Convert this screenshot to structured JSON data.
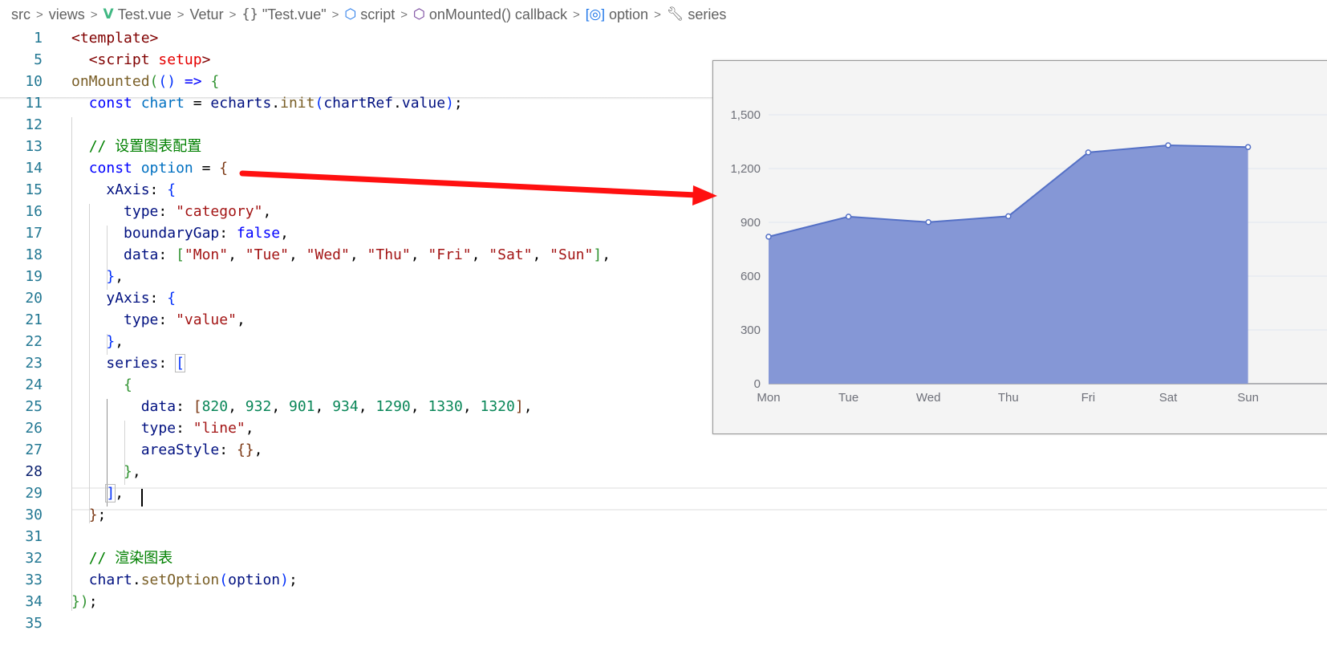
{
  "breadcrumb": [
    {
      "label": "src",
      "icon": ""
    },
    {
      "label": "views",
      "icon": ""
    },
    {
      "label": "Test.vue",
      "icon": "vue-icon"
    },
    {
      "label": "Vetur",
      "icon": ""
    },
    {
      "label": "\"Test.vue\"",
      "icon": "braces-icon"
    },
    {
      "label": "script",
      "icon": "cube-icon"
    },
    {
      "label": "onMounted() callback",
      "icon": "cube-icon"
    },
    {
      "label": "option",
      "icon": "field-icon"
    },
    {
      "label": "series",
      "icon": "wrench-icon"
    }
  ],
  "editor": {
    "line_numbers": [
      "1",
      "5",
      "10",
      "11",
      "12",
      "13",
      "14",
      "15",
      "16",
      "17",
      "18",
      "19",
      "20",
      "21",
      "22",
      "23",
      "24",
      "25",
      "26",
      "27",
      "28",
      "29",
      "30",
      "31",
      "32",
      "33",
      "34",
      "35"
    ],
    "active_line": "28"
  },
  "chart_data": {
    "type": "area",
    "categories": [
      "Mon",
      "Tue",
      "Wed",
      "Thu",
      "Fri",
      "Sat",
      "Sun"
    ],
    "values": [
      820,
      932,
      901,
      934,
      1290,
      1330,
      1320
    ],
    "y_ticks": [
      "0",
      "300",
      "600",
      "900",
      "1,200",
      "1,500"
    ],
    "ylim": [
      0,
      1500
    ],
    "grid": true,
    "line_color": "#5470c6",
    "area_color": "#8597d6"
  },
  "colors": {
    "arrow": "#ff1010",
    "line_number": "#237893"
  }
}
